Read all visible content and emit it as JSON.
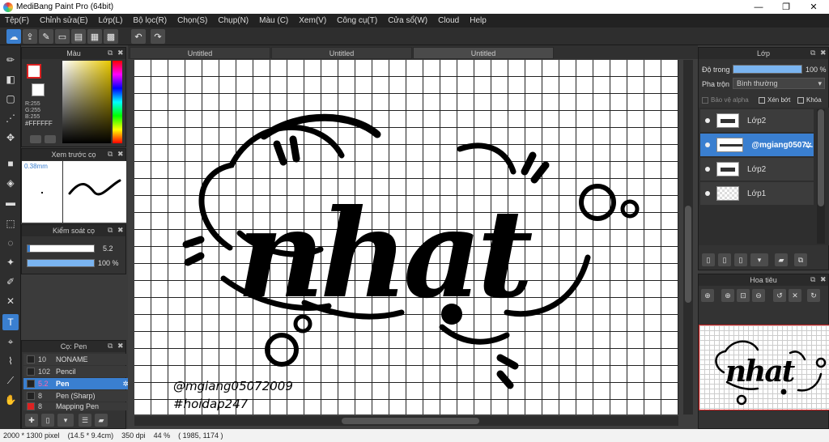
{
  "window": {
    "title": "MediBang Paint Pro (64bit)",
    "minimize": "—",
    "maximize": "❐",
    "close": "✕"
  },
  "menu": [
    "Tệp(F)",
    "Chỉnh sửa(E)",
    "Lớp(L)",
    "Bộ lọc(R)",
    "Chọn(S)",
    "Chụp(N)",
    "Màu (C)",
    "Xem(V)",
    "Công cụ(T)",
    "Cửa sổ(W)",
    "Cloud",
    "Help"
  ],
  "toolbar": {
    "undo_icon": "undo-icon",
    "redo_icon": "redo-icon"
  },
  "color_panel": {
    "title": "Màu",
    "r": "R:255",
    "g": "G:255",
    "b": "B:255",
    "hex": "#FFFFFF",
    "foreground": "#ffffff",
    "background": "#ffffff"
  },
  "preview_panel": {
    "title": "Xem trước cọ",
    "size": "0.38mm"
  },
  "brush_control": {
    "title": "Kiểm soát cọ",
    "size": "5.2",
    "opacity": "100 %",
    "opacity_fraction": 1.0
  },
  "brush_panel": {
    "title": "Cọ: Pen",
    "items": [
      {
        "size": "10",
        "name": "NONAME"
      },
      {
        "size": "102",
        "name": "Pencil"
      },
      {
        "size": "5.2",
        "name": "Pen"
      },
      {
        "size": "8",
        "name": "Pen (Sharp)"
      },
      {
        "size": "8",
        "name": "Mapping Pen"
      }
    ]
  },
  "tabs": [
    "Untitled",
    "Untitled",
    "Untitled"
  ],
  "artwork": {
    "word": "nhat",
    "credit1": "@mgiang05072009",
    "credit2": "#hoidap247"
  },
  "layer_panel": {
    "title": "Lớp",
    "opacity_label": "Độ trong",
    "opacity_value": "100 %",
    "opacity_fraction": 1.0,
    "blend_label": "Pha trộn",
    "blend_value": "Bình thường",
    "alpha_lock": "Bảo vệ alpha",
    "clip": "Xén bớt",
    "lock": "Khóa",
    "layers": [
      {
        "name": "Lớp2"
      },
      {
        "name": "@mgiang0507..."
      },
      {
        "name": "Lớp2"
      },
      {
        "name": "Lớp1"
      }
    ]
  },
  "navigator": {
    "title": "Hoa tiêu"
  },
  "status": {
    "size": "2000 * 1300 pixel",
    "physical": "(14.5 * 9.4cm)",
    "dpi": "350 dpi",
    "zoom": "44 %",
    "coords": "( 1985, 1174 )"
  }
}
